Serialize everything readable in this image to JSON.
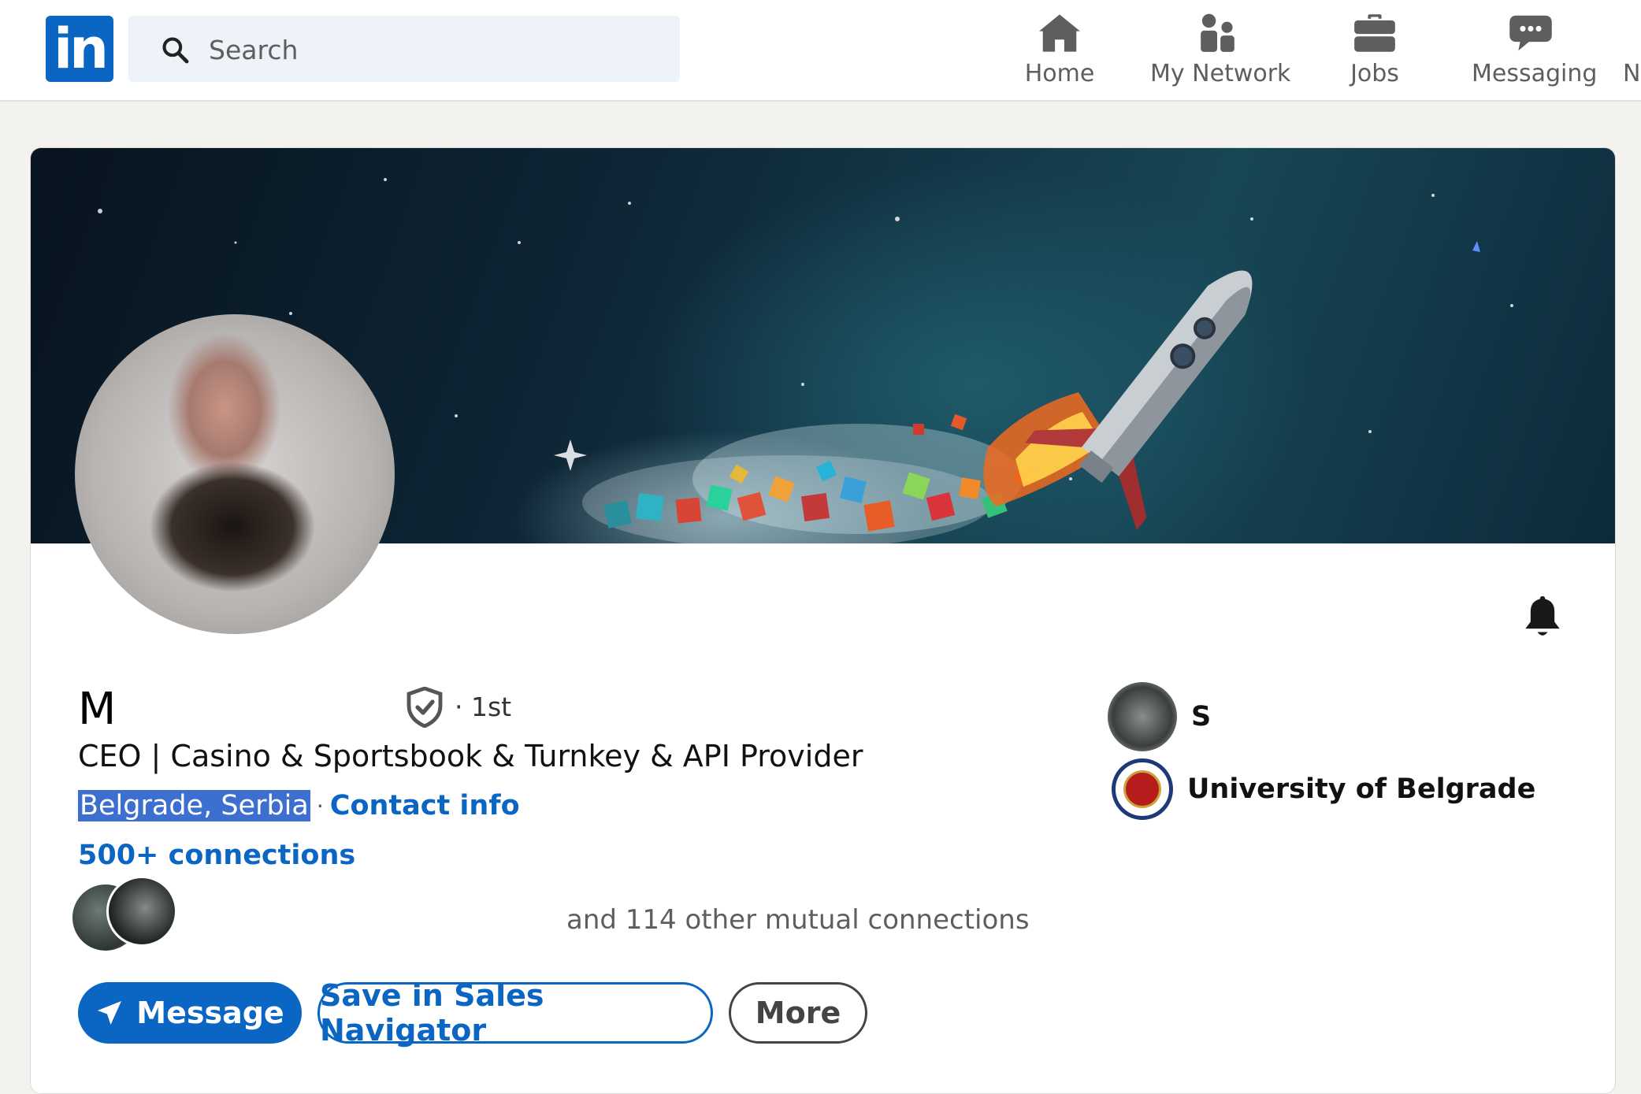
{
  "nav": {
    "logo_text": "in",
    "search_placeholder": "Search",
    "items": [
      {
        "label": "Home",
        "icon": "home-icon"
      },
      {
        "label": "My Network",
        "icon": "people-icon"
      },
      {
        "label": "Jobs",
        "icon": "briefcase-icon"
      },
      {
        "label": "Messaging",
        "icon": "chat-icon"
      },
      {
        "label": "N",
        "icon": "notifications-icon"
      }
    ]
  },
  "profile": {
    "name": "M",
    "degree": "· 1st",
    "headline": "CEO | Casino & Sportsbook & Turnkey & API Provider",
    "location": "Belgrade, Serbia",
    "location_separator": "·",
    "contact_info": "Contact info",
    "connections": "500+ connections",
    "mutual_connections": "and 114 other mutual connections",
    "company_name": "S",
    "education": "University of Belgrade"
  },
  "actions": {
    "message": "Message",
    "save_sales_navigator": "Save in Sales Navigator",
    "more": "More"
  },
  "colors": {
    "brand_blue": "#0a66c2",
    "page_bg": "#f4f2ee",
    "selection": "#3c6fcf"
  }
}
